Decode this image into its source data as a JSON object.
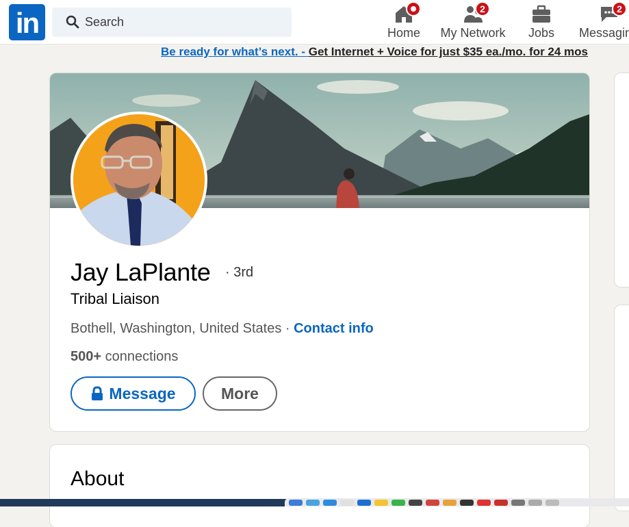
{
  "nav": {
    "logo_text": "in",
    "search": {
      "placeholder": "Search"
    },
    "items": [
      {
        "label": "Home",
        "icon": "home-icon",
        "badge": ""
      },
      {
        "label": "My Network",
        "icon": "people-icon",
        "badge": "2"
      },
      {
        "label": "Jobs",
        "icon": "briefcase-icon",
        "badge": ""
      },
      {
        "label": "Messagin",
        "icon": "chat-icon",
        "badge": "2"
      }
    ]
  },
  "ad": {
    "link": "Be ready for what’s next. - ",
    "text": "Get Internet + Voice for just $35 ea./mo. for 24 mos"
  },
  "profile": {
    "name": "Jay LaPlante",
    "degree": "· 3rd",
    "headline": "Tribal Liaison",
    "location": "Bothell, Washington, United States · ",
    "contact_label": "Contact info",
    "connections_count": "500+",
    "connections_label": " connections",
    "message_button": "Message",
    "more_button": "More"
  },
  "about": {
    "title": "About"
  },
  "colors": {
    "brand": "#0a66c2",
    "badge": "#cc1016",
    "page_background": "#f3f2ef"
  }
}
